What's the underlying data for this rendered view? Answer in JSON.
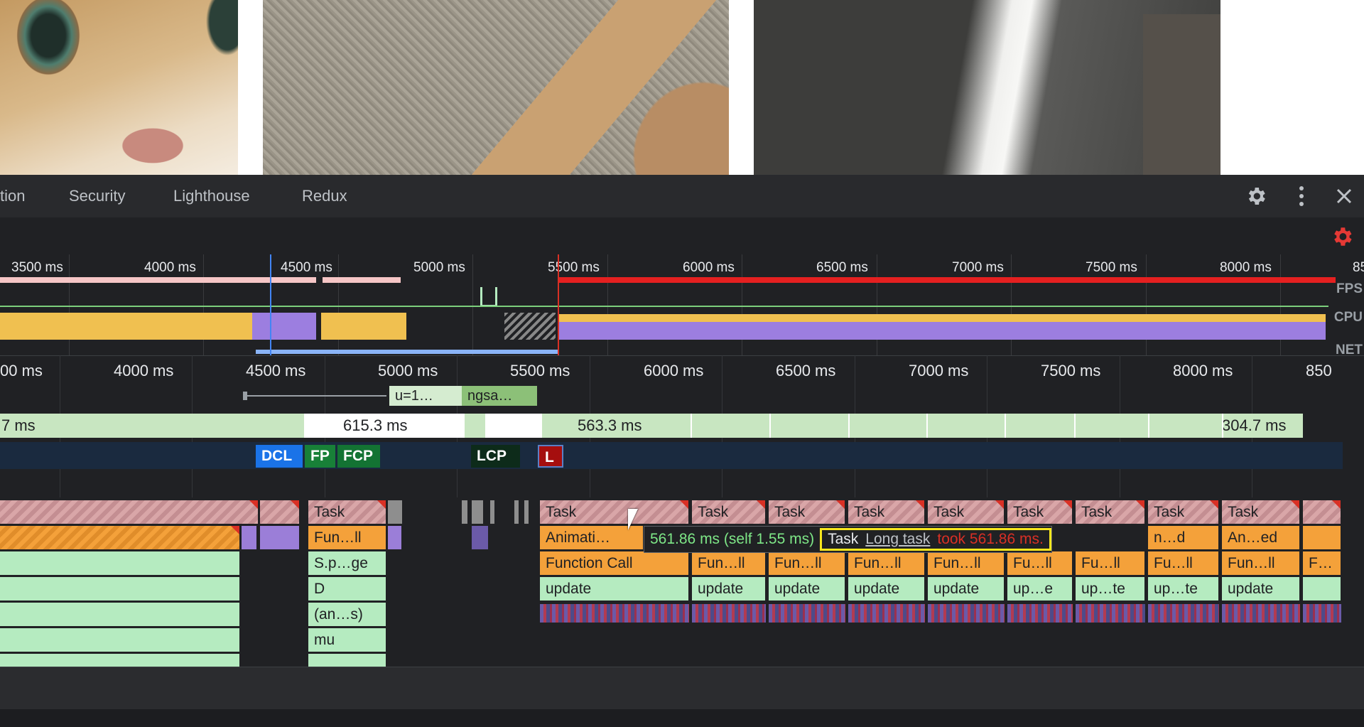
{
  "devtools": {
    "tabs": [
      "tion",
      "Security",
      "Lighthouse",
      "Redux"
    ],
    "icons": [
      "gear-icon",
      "more-vert-icon",
      "close-icon",
      "capture-settings-icon"
    ],
    "accent_color": "#e53935"
  },
  "overview": {
    "ticks": [
      "3500 ms",
      "4000 ms",
      "4500 ms",
      "5000 ms",
      "5500 ms",
      "6000 ms",
      "6500 ms",
      "7000 ms",
      "7500 ms",
      "8000 ms",
      "85"
    ],
    "labels": {
      "fps": "FPS",
      "cpu": "CPU",
      "net": "NET"
    }
  },
  "ruler": {
    "ticks": [
      "00 ms",
      "4000 ms",
      "4500 ms",
      "5000 ms",
      "5500 ms",
      "6000 ms",
      "6500 ms",
      "7000 ms",
      "7500 ms",
      "8000 ms",
      "850"
    ]
  },
  "network": {
    "items": [
      "u=1…",
      "ngsa…"
    ]
  },
  "frames": {
    "items": [
      "7 ms",
      "615.3 ms",
      "563.3 ms",
      "304.7 ms"
    ]
  },
  "timings": {
    "markers": [
      "DCL",
      "FP",
      "FCP",
      "LCP",
      "L"
    ],
    "colors": {
      "dcl": "#1a73e8",
      "fp": "#188038",
      "fcp": "#137333",
      "lcp": "#0d2b1a",
      "l": "#a50e0e"
    }
  },
  "flame": {
    "task_label": "Task",
    "row1": [
      "Fun…ll",
      "Animati…",
      "n…d",
      "An…ed"
    ],
    "row2": [
      "S.p…ge",
      "Function Call",
      "Fun…ll",
      "Fun…ll",
      "Fun…ll",
      "Fun…ll",
      "Fu…ll",
      "Fu…ll",
      "Fu…ll",
      "Fun…ll",
      "F…"
    ],
    "row3": [
      "D",
      "update",
      "update",
      "update",
      "update",
      "update",
      "up…e",
      "up…te",
      "up…te",
      "update"
    ],
    "row4": [
      "(an…s)"
    ],
    "row5": [
      "mu"
    ]
  },
  "tooltip": {
    "time": "561.86 ms (self 1.55 ms)",
    "task": "Task",
    "link": "Long task",
    "took": "took 561.86 ms."
  }
}
